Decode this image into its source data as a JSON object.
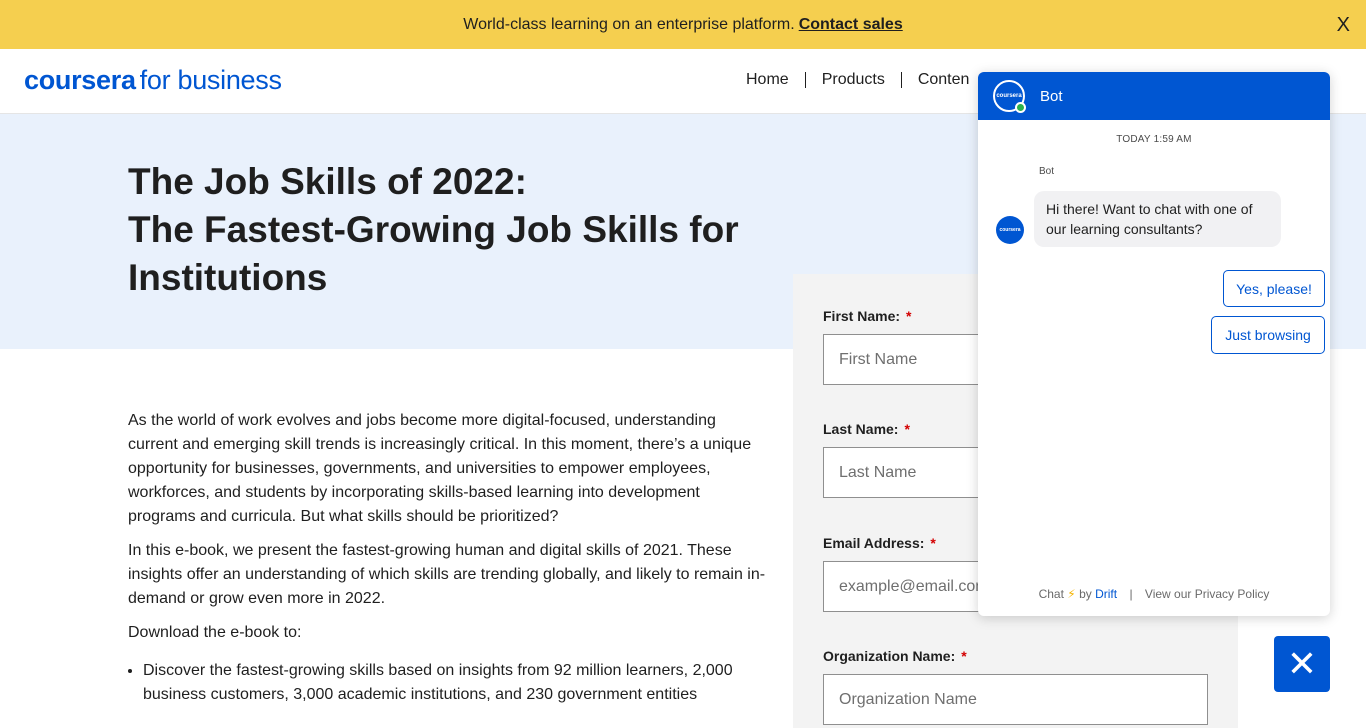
{
  "banner": {
    "text": "World-class learning on an enterprise platform.",
    "link": "Contact sales",
    "close": "X"
  },
  "header": {
    "logo_brand": "coursera",
    "logo_suffix": "for business",
    "nav": [
      "Home",
      "Products",
      "Conten"
    ]
  },
  "hero": {
    "title_line1": "The Job Skills of 2022:",
    "title_line2": "The Fastest-Growing Job Skills for Institutions"
  },
  "content": {
    "p1": "As the world of work evolves and jobs become more digital-focused, understanding current and emerging skill trends is increasingly critical. In this moment, there’s a unique opportunity for businesses, governments, and universities to empower employees, workforces, and students by incorporating skills-based learning into development programs and curricula. But what skills should be prioritized?",
    "p2": "In this e-book, we present the fastest-growing human and digital skills of 2021. These insights offer an understanding of which skills are trending globally, and likely to remain in-demand or grow even more in 2022.",
    "p3": "Download the e-book to:",
    "bullets": [
      "Discover the fastest-growing skills based on insights from 92 million learners, 2,000 business customers, 3,000 academic institutions, and 230 government entities"
    ]
  },
  "form": {
    "first_name": {
      "label": "First Name:",
      "required": "*",
      "placeholder": "First Name",
      "value": ""
    },
    "last_name": {
      "label": "Last Name:",
      "required": "*",
      "placeholder": "Last Name",
      "value": ""
    },
    "email": {
      "label": "Email Address:",
      "required": "*",
      "placeholder": "example@email.com",
      "value": ""
    },
    "organization": {
      "label": "Organization Name:",
      "required": "*",
      "placeholder": "Organization Name",
      "value": ""
    }
  },
  "chat": {
    "bot_name": "Bot",
    "avatar_text": "coursera",
    "timestamp": "TODAY 1:59 AM",
    "sender": "Bot",
    "message": "Hi there! Want to chat with one of our learning consultants?",
    "replies": [
      "Yes, please!",
      "Just browsing"
    ],
    "footer_chat": "Chat",
    "footer_by": "by",
    "footer_drift": "Drift",
    "footer_sep": "|",
    "footer_privacy": "View our Privacy Policy",
    "bolt": "⚡"
  },
  "chat_toggle": {
    "icon": "close-icon",
    "glyph": "✕"
  },
  "colors": {
    "accent": "#0056d2",
    "banner": "#f5cf4f",
    "hero": "#e9f1fc",
    "form_panel": "#f3f3f3",
    "required": "#d30001"
  }
}
